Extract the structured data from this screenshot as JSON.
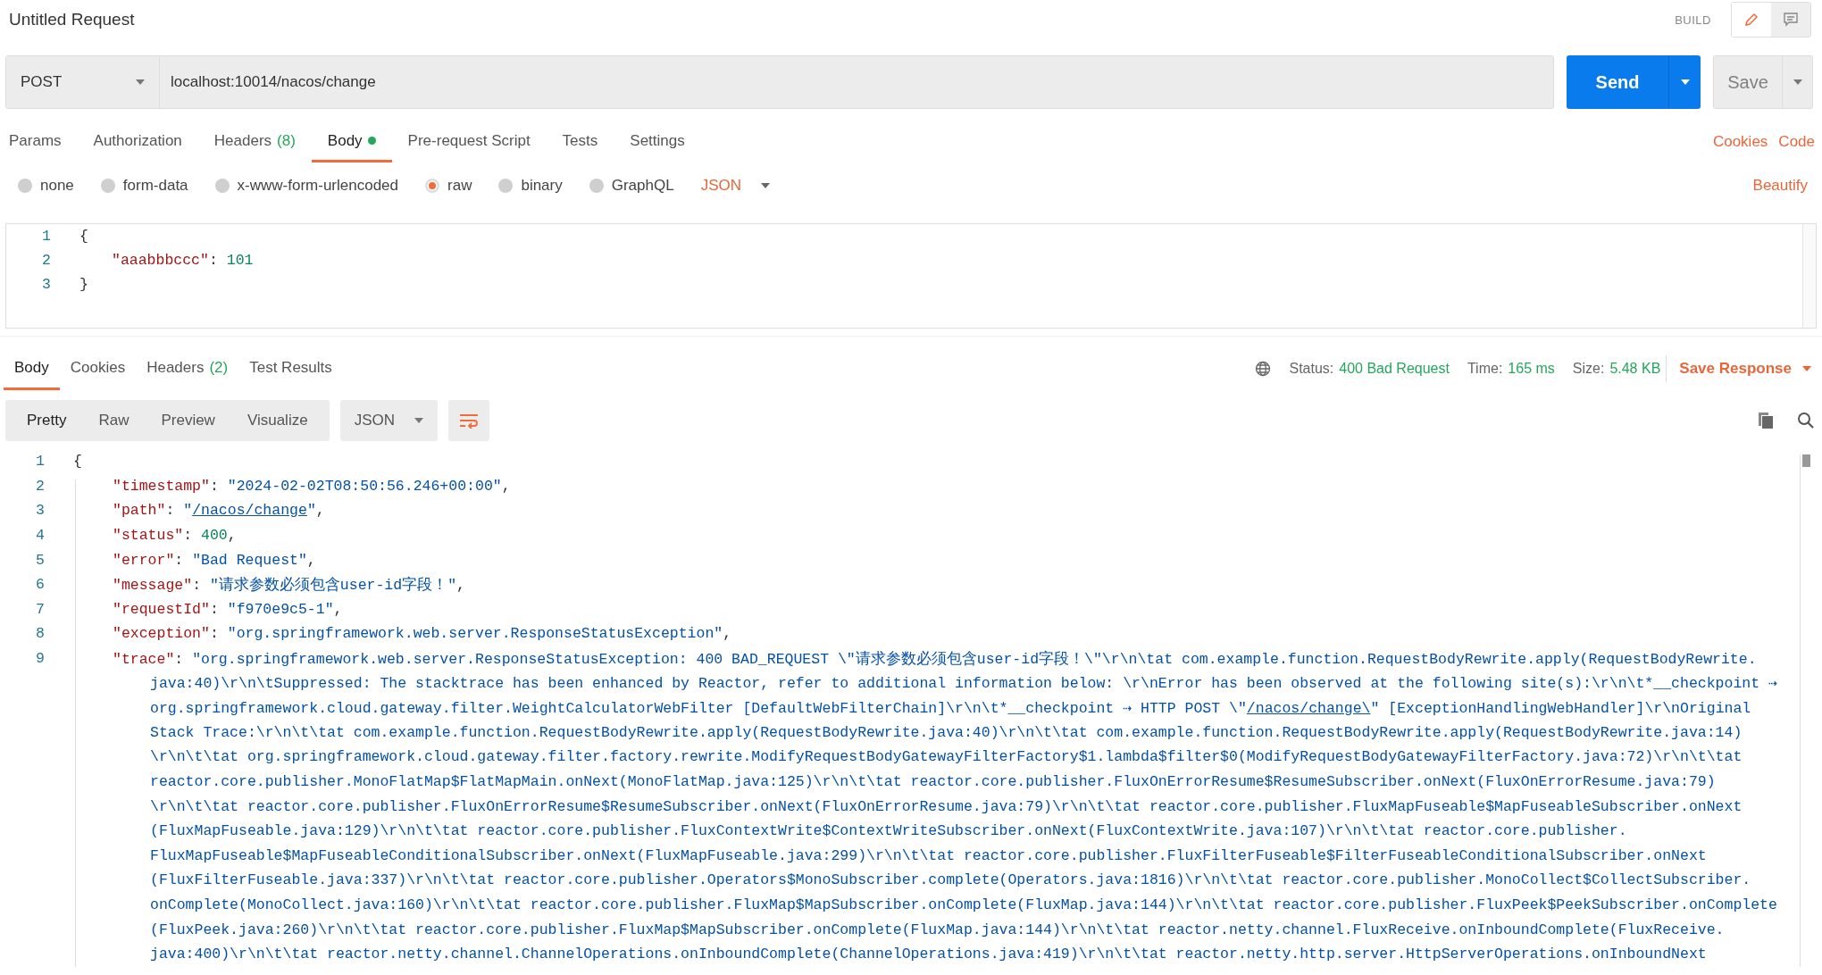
{
  "title": "Untitled Request",
  "mode": "BUILD",
  "mode_buttons": [
    {
      "kind": "edit",
      "selected": true
    },
    {
      "kind": "comments",
      "selected": false
    }
  ],
  "request": {
    "method": "POST",
    "url": "localhost:10014/nacos/change",
    "send": "Send",
    "save": "Save"
  },
  "request_tabs": [
    {
      "label": "Params",
      "selected": false
    },
    {
      "label": "Authorization",
      "selected": false
    },
    {
      "label": "Headers",
      "count": "(8)",
      "selected": false
    },
    {
      "label": "Body",
      "selected": true,
      "dot": true
    },
    {
      "label": "Pre-request Script",
      "selected": false
    },
    {
      "label": "Tests",
      "selected": false
    },
    {
      "label": "Settings",
      "selected": false
    }
  ],
  "request_links": [
    "Cookies",
    "Code"
  ],
  "body_types": [
    {
      "label": "none",
      "selected": false
    },
    {
      "label": "form-data",
      "selected": false
    },
    {
      "label": "x-www-form-urlencoded",
      "selected": false
    },
    {
      "label": "raw",
      "selected": true
    },
    {
      "label": "binary",
      "selected": false
    },
    {
      "label": "GraphQL",
      "selected": false
    }
  ],
  "body_language": "JSON",
  "beautify": "Beautify",
  "request_body": [
    {
      "number": "1",
      "kind": "brace",
      "tokens": [
        {
          "kind": "punct",
          "text": "{"
        }
      ]
    },
    {
      "number": "2",
      "kind": "member",
      "tokens": [
        {
          "kind": "key",
          "text": "\"aaabbbccc\""
        },
        {
          "kind": "punct",
          "text": ": "
        },
        {
          "kind": "number",
          "text": "101"
        }
      ]
    },
    {
      "number": "3",
      "kind": "brace",
      "tokens": [
        {
          "kind": "punct",
          "text": "}"
        }
      ]
    }
  ],
  "response_tabs": [
    {
      "label": "Body",
      "selected": true
    },
    {
      "label": "Cookies",
      "selected": false
    },
    {
      "label": "Headers",
      "count": "(2)",
      "selected": false
    },
    {
      "label": "Test Results",
      "selected": false
    }
  ],
  "response_meta": [
    {
      "label": "Status:",
      "value": "400 Bad Request"
    },
    {
      "label": "Time:",
      "value": "165 ms"
    },
    {
      "label": "Size:",
      "value": "5.48 KB"
    }
  ],
  "save_response": "Save Response",
  "view_modes": [
    {
      "label": "Pretty",
      "selected": true
    },
    {
      "label": "Raw",
      "selected": false
    },
    {
      "label": "Preview",
      "selected": false
    },
    {
      "label": "Visualize",
      "selected": false
    }
  ],
  "response_language": "JSON",
  "wrap_lines": true,
  "response_body": [
    {
      "number": "1",
      "kind": "brace",
      "tokens": [
        {
          "kind": "punct",
          "text": "{"
        }
      ]
    },
    {
      "number": "2",
      "kind": "member",
      "tokens": [
        {
          "kind": "key",
          "text": "\"timestamp\""
        },
        {
          "kind": "punct",
          "text": ": "
        },
        {
          "kind": "string",
          "text": "\"2024-02-02T08:50:56.246+00:00\""
        },
        {
          "kind": "punct",
          "text": ","
        }
      ]
    },
    {
      "number": "3",
      "kind": "member",
      "tokens": [
        {
          "kind": "key",
          "text": "\"path\""
        },
        {
          "kind": "punct",
          "text": ": "
        },
        {
          "kind": "string",
          "text": "\""
        },
        {
          "kind": "link",
          "text": "/nacos/change"
        },
        {
          "kind": "string",
          "text": "\""
        },
        {
          "kind": "punct",
          "text": ","
        }
      ]
    },
    {
      "number": "4",
      "kind": "member",
      "tokens": [
        {
          "kind": "key",
          "text": "\"status\""
        },
        {
          "kind": "punct",
          "text": ": "
        },
        {
          "kind": "number",
          "text": "400"
        },
        {
          "kind": "punct",
          "text": ","
        }
      ]
    },
    {
      "number": "5",
      "kind": "member",
      "tokens": [
        {
          "kind": "key",
          "text": "\"error\""
        },
        {
          "kind": "punct",
          "text": ": "
        },
        {
          "kind": "string",
          "text": "\"Bad Request\""
        },
        {
          "kind": "punct",
          "text": ","
        }
      ]
    },
    {
      "number": "6",
      "kind": "member",
      "tokens": [
        {
          "kind": "key",
          "text": "\"message\""
        },
        {
          "kind": "punct",
          "text": ": "
        },
        {
          "kind": "string",
          "text": "\"请求参数必须包含user-id字段！\""
        },
        {
          "kind": "punct",
          "text": ","
        }
      ]
    },
    {
      "number": "7",
      "kind": "member",
      "tokens": [
        {
          "kind": "key",
          "text": "\"requestId\""
        },
        {
          "kind": "punct",
          "text": ": "
        },
        {
          "kind": "string",
          "text": "\"f970e9c5-1\""
        },
        {
          "kind": "punct",
          "text": ","
        }
      ]
    },
    {
      "number": "8",
      "kind": "member",
      "tokens": [
        {
          "kind": "key",
          "text": "\"exception\""
        },
        {
          "kind": "punct",
          "text": ": "
        },
        {
          "kind": "string",
          "text": "\"org.springframework.web.server.ResponseStatusException\""
        },
        {
          "kind": "punct",
          "text": ","
        }
      ]
    },
    {
      "number": "9",
      "kind": "member",
      "tokens": [
        {
          "kind": "key",
          "text": "\"trace\""
        },
        {
          "kind": "punct",
          "text": ": "
        },
        {
          "kind": "string",
          "text": "\"org.springframework.web.server.ResponseStatusException: 400 BAD_REQUEST \\\"请求参数必须包含user-id字段！\\\"\\r\\n\\tat com.example.function.RequestBodyRewrite.apply(RequestBodyRewrite."
        }
      ]
    },
    {
      "kind": "wrap",
      "tokens": [
        {
          "kind": "string",
          "text": "java:40)\\r\\n\\tSuppressed: The stacktrace has been enhanced by Reactor, refer to additional information below: \\r\\nError has been observed at the following site(s):\\r\\n\\t*__checkpoint ⇢"
        }
      ]
    },
    {
      "kind": "wrap",
      "tokens": [
        {
          "kind": "string",
          "text": "org.springframework.cloud.gateway.filter.WeightCalculatorWebFilter [DefaultWebFilterChain]\\r\\n\\t*__checkpoint ⇢ HTTP POST \\\""
        },
        {
          "kind": "link",
          "text": "/nacos/change\\"
        },
        {
          "kind": "string",
          "text": "\" [ExceptionHandlingWebHandler]\\r\\nOriginal"
        }
      ]
    },
    {
      "kind": "wrap",
      "tokens": [
        {
          "kind": "string",
          "text": "Stack Trace:\\r\\n\\t\\tat com.example.function.RequestBodyRewrite.apply(RequestBodyRewrite.java:40)\\r\\n\\t\\tat com.example.function.RequestBodyRewrite.apply(RequestBodyRewrite.java:14)"
        }
      ]
    },
    {
      "kind": "wrap",
      "tokens": [
        {
          "kind": "string",
          "text": "\\r\\n\\t\\tat org.springframework.cloud.gateway.filter.factory.rewrite.ModifyRequestBodyGatewayFilterFactory$1.lambda$filter$0(ModifyRequestBodyGatewayFilterFactory.java:72)\\r\\n\\t\\tat"
        }
      ]
    },
    {
      "kind": "wrap",
      "tokens": [
        {
          "kind": "string",
          "text": "reactor.core.publisher.MonoFlatMap$FlatMapMain.onNext(MonoFlatMap.java:125)\\r\\n\\t\\tat reactor.core.publisher.FluxOnErrorResume$ResumeSubscriber.onNext(FluxOnErrorResume.java:79)"
        }
      ]
    },
    {
      "kind": "wrap",
      "tokens": [
        {
          "kind": "string",
          "text": "\\r\\n\\t\\tat reactor.core.publisher.FluxOnErrorResume$ResumeSubscriber.onNext(FluxOnErrorResume.java:79)\\r\\n\\t\\tat reactor.core.publisher.FluxMapFuseable$MapFuseableSubscriber.onNext"
        }
      ]
    },
    {
      "kind": "wrap",
      "tokens": [
        {
          "kind": "string",
          "text": "(FluxMapFuseable.java:129)\\r\\n\\t\\tat reactor.core.publisher.FluxContextWrite$ContextWriteSubscriber.onNext(FluxContextWrite.java:107)\\r\\n\\t\\tat reactor.core.publisher."
        }
      ]
    },
    {
      "kind": "wrap",
      "tokens": [
        {
          "kind": "string",
          "text": "FluxMapFuseable$MapFuseableConditionalSubscriber.onNext(FluxMapFuseable.java:299)\\r\\n\\t\\tat reactor.core.publisher.FluxFilterFuseable$FilterFuseableConditionalSubscriber.onNext"
        }
      ]
    },
    {
      "kind": "wrap",
      "tokens": [
        {
          "kind": "string",
          "text": "(FluxFilterFuseable.java:337)\\r\\n\\t\\tat reactor.core.publisher.Operators$MonoSubscriber.complete(Operators.java:1816)\\r\\n\\t\\tat reactor.core.publisher.MonoCollect$CollectSubscriber."
        }
      ]
    },
    {
      "kind": "wrap",
      "tokens": [
        {
          "kind": "string",
          "text": "onComplete(MonoCollect.java:160)\\r\\n\\t\\tat reactor.core.publisher.FluxMap$MapSubscriber.onComplete(FluxMap.java:144)\\r\\n\\t\\tat reactor.core.publisher.FluxPeek$PeekSubscriber.onComplete"
        }
      ]
    },
    {
      "kind": "wrap",
      "tokens": [
        {
          "kind": "string",
          "text": "(FluxPeek.java:260)\\r\\n\\t\\tat reactor.core.publisher.FluxMap$MapSubscriber.onComplete(FluxMap.java:144)\\r\\n\\t\\tat reactor.netty.channel.FluxReceive.onInboundComplete(FluxReceive."
        }
      ]
    },
    {
      "kind": "wrap",
      "tokens": [
        {
          "kind": "string",
          "text": "java:400)\\r\\n\\t\\tat reactor.netty.channel.ChannelOperations.onInboundComplete(ChannelOperations.java:419)\\r\\n\\t\\tat reactor.netty.http.server.HttpServerOperations.onInboundNext"
        }
      ]
    }
  ]
}
